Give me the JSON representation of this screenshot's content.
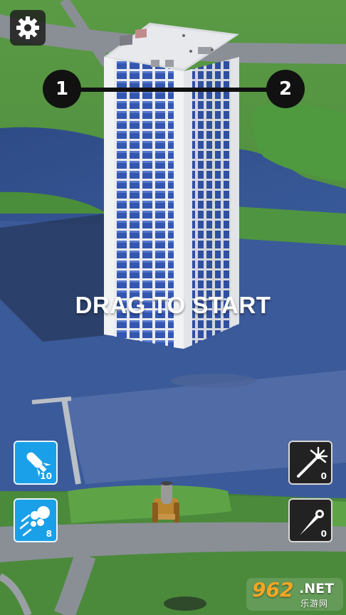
{
  "hud": {
    "settings_icon": "gear-icon",
    "level_progress": {
      "current_level": "1",
      "next_level": "2"
    },
    "instruction": "DRAG TO START"
  },
  "powerups": {
    "missile": {
      "icon": "missile-icon",
      "count": "10"
    },
    "cluster": {
      "icon": "cluster-shot-icon",
      "count": "8"
    },
    "spark": {
      "icon": "spark-wand-icon",
      "count": "0"
    },
    "comet": {
      "icon": "comet-icon",
      "count": "0"
    }
  },
  "watermark": {
    "number": "962",
    "domain": ".NET",
    "caption": "乐游网"
  },
  "colors": {
    "powerup_blue": "#1aa0e8",
    "powerup_dark": "#222222",
    "grass": "#4f8f3c",
    "water": "#2f4f8f",
    "building_glass": "#2f4fa8"
  }
}
